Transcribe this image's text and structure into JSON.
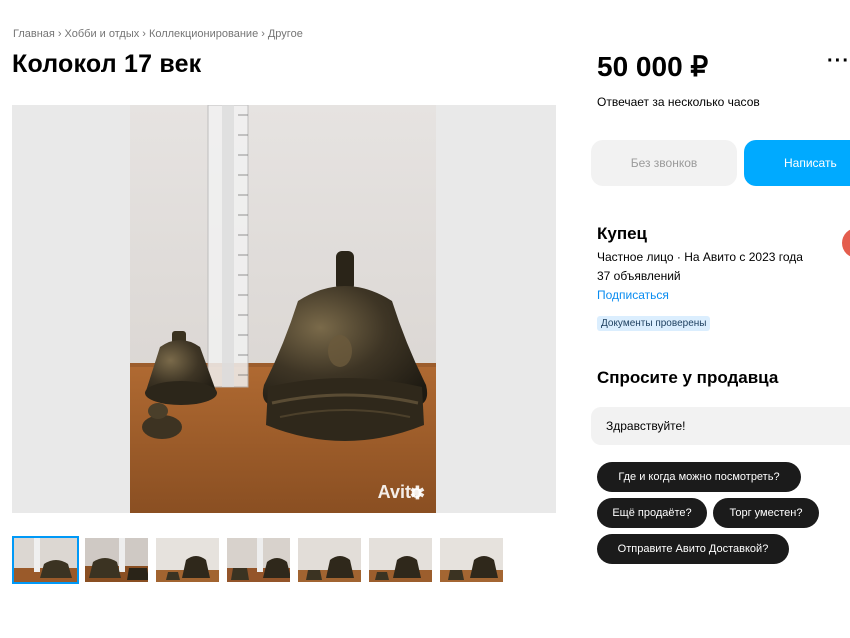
{
  "breadcrumb": {
    "home": "Главная",
    "cat1": "Хобби и отдых",
    "cat2": "Коллекционирование",
    "cat3": "Другое",
    "sep": "›"
  },
  "listing": {
    "title": "Колокол 17 век",
    "price": "50 000 ₽",
    "responds": "Отвечает за несколько часов",
    "watermark": "Avito",
    "thumbnail_count": 7
  },
  "actions": {
    "no_calls": "Без звонков",
    "write": "Написать",
    "more": "···"
  },
  "seller": {
    "name": "Купец",
    "info": "Частное лицо · На Авито с 2023 года",
    "ads": "37 объявлений",
    "subscribe": "Подписаться",
    "verified": "Документы проверены",
    "avatar_color": "#e45e4e"
  },
  "ask": {
    "title": "Спросите у продавца",
    "input_value": "Здравствуйте!",
    "chips": [
      "Где и когда можно посмотреть?",
      "Ещё продаёте?",
      "Торг уместен?",
      "Отправите Авито Доставкой?"
    ]
  },
  "colors": {
    "accent": "#00aaff",
    "link": "#0a8cf0",
    "chip": "#1b1b1b"
  }
}
